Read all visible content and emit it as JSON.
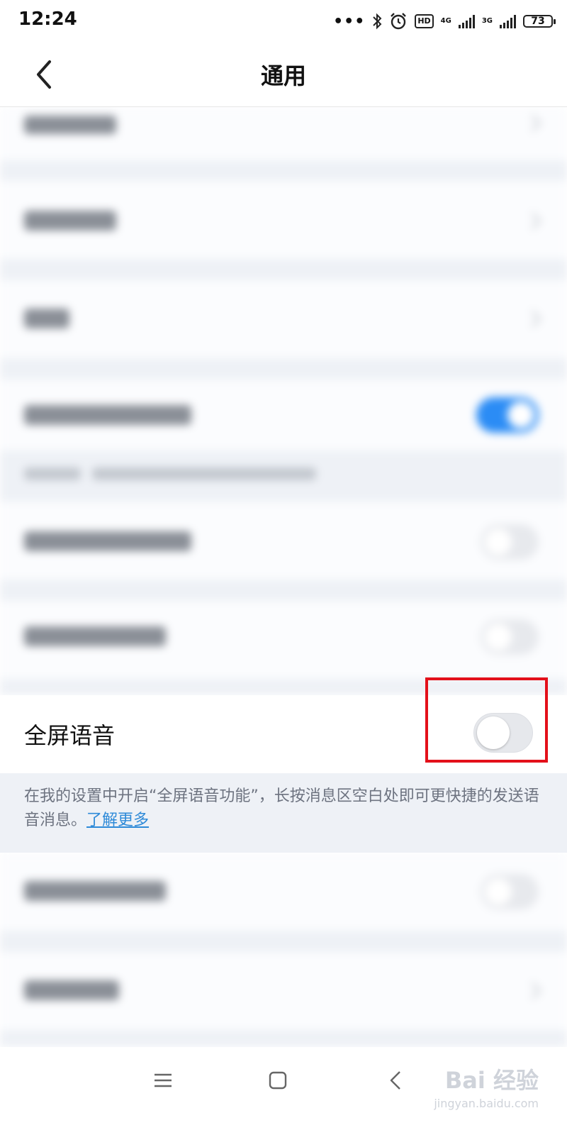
{
  "status_bar": {
    "time": "12:24",
    "dots": "•••",
    "hd_label": "HD",
    "network_1": "4G",
    "network_2": "3G",
    "battery": "73"
  },
  "header": {
    "title": "通用",
    "back_icon": "chevron-left-icon"
  },
  "blurred_rows": {
    "toggle_on_color": "#2b8cf5"
  },
  "full_screen_voice": {
    "label": "全屏语音",
    "toggle_state": "off",
    "description": "在我的设置中开启“全屏语音功能”，长按消息区空白处即可更快捷的发送语音消息。",
    "link_text": "了解更多",
    "highlight_color": "#e3101a",
    "link_color": "#2e8ad8"
  },
  "system_nav": {
    "menu_icon": "menu-icon",
    "home_icon": "home-square-icon",
    "back_icon": "triangle-back-icon"
  },
  "watermark": {
    "text": "Bai 经验",
    "subtext": "jingyan.baidu.com"
  }
}
